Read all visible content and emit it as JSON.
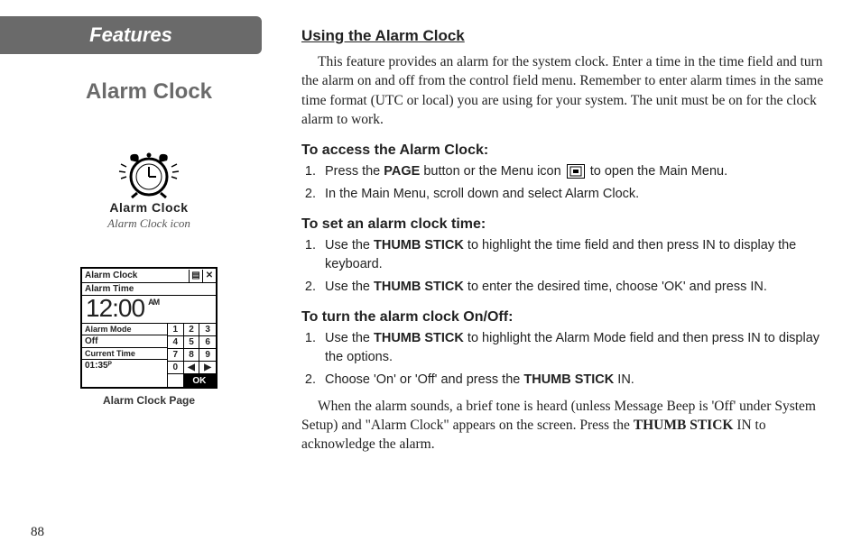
{
  "pageNumber": "88",
  "tab": "Features",
  "sectionTitle": "Alarm Clock",
  "iconLabel": "Alarm Clock",
  "iconCaption": "Alarm Clock icon",
  "pageCaption": "Alarm Clock Page",
  "mini": {
    "title": "Alarm Clock",
    "alarmTimeLabel": "Alarm Time",
    "alarmTime": "12:00",
    "ampm": "AM",
    "alarmModeLabel": "Alarm Mode",
    "alarmMode": "Off",
    "currentTimeLabel": "Current Time",
    "currentTime": "01:35ᴾ",
    "keypad": [
      "1",
      "2",
      "3",
      "4",
      "5",
      "6",
      "7",
      "8",
      "9",
      "0",
      "◀",
      "▶"
    ],
    "ok": "OK"
  },
  "main": {
    "heading": "Using the Alarm Clock",
    "intro": "This feature provides an alarm for the system clock.  Enter a time in the time field and turn the alarm on and off from the control field menu.  Remember to enter alarm times in the same time format (UTC or local) you are using for your system.  The unit must be on for the clock alarm to work.",
    "accessHead": "To access the Alarm Clock:",
    "accessSteps": [
      {
        "pre": "Press the ",
        "bold1": "PAGE",
        "mid": " button or the Menu icon ",
        "post": " to open the Main Menu."
      },
      {
        "text": "In the Main Menu, scroll down and select Alarm Clock."
      }
    ],
    "setHead": "To set an alarm clock time:",
    "setSteps": [
      {
        "pre": "Use the ",
        "bold1": "THUMB STICK",
        "post": " to highlight the time field and then press IN to display the keyboard."
      },
      {
        "pre": "Use the ",
        "bold1": "THUMB STICK",
        "post": " to enter the desired time, choose 'OK' and press IN."
      }
    ],
    "onoffHead": "To turn the alarm clock On/Off:",
    "onoffSteps": [
      {
        "pre": "Use the ",
        "bold1": "THUMB STICK",
        "post": " to highlight the Alarm Mode field and then press IN to display the options."
      },
      {
        "pre": "Choose 'On' or 'Off' and press the ",
        "bold1": "THUMB STICK",
        "post": " IN."
      }
    ],
    "outroPre": "When the alarm sounds, a brief tone is heard (unless Message Beep is 'Off' under System Setup) and \"Alarm Clock\" appears on the screen.  Press the ",
    "outroBold": "THUMB STICK",
    "outroPost": " IN to acknowledge the alarm."
  }
}
